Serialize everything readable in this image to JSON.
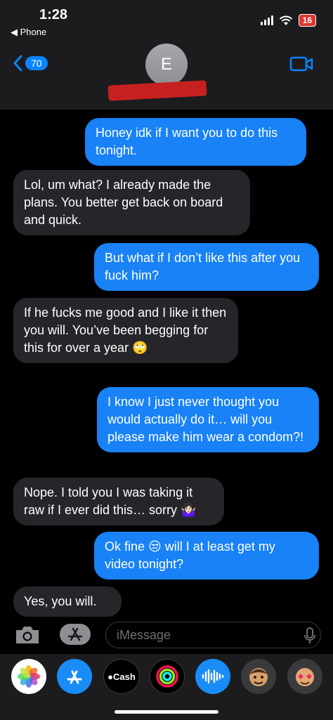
{
  "status": {
    "time": "1:28",
    "back_app": "◀ Phone",
    "battery": "16"
  },
  "header": {
    "back_badge": "70",
    "avatar_initial": "E",
    "back_icon": "chevron-left-icon",
    "video_icon": "video-camera-icon"
  },
  "messages": [
    {
      "side": "sent",
      "text": "Honey idk if I want you to do this tonight."
    },
    {
      "side": "received",
      "text": "Lol, um what? I already made the plans. You better get back on board and quick."
    },
    {
      "side": "sent",
      "text": "But what if I don’t like this after you fuck him?"
    },
    {
      "side": "received",
      "text": "If he fucks me good and I like it then you will. You’ve been begging for this for over a year 🙄"
    },
    {
      "side": "sent",
      "text": "I know I just never thought you would actually do it… will you please make him wear a condom?!"
    },
    {
      "side": "received",
      "text": "Nope. I told you I was taking it raw if I ever did this… sorry 🤷🏻‍♀️"
    },
    {
      "side": "sent",
      "text": "Ok fine 😒 will I at least get my video tonight?"
    },
    {
      "side": "received",
      "text": "Yes, you will."
    }
  ],
  "composer": {
    "placeholder": "iMessage",
    "camera_icon": "camera-icon",
    "apps_icon": "app-store-icon",
    "mic_icon": "microphone-icon"
  },
  "app_drawer": {
    "cash_label": "Cash",
    "apps": [
      "photos-icon",
      "app-store-icon",
      "apple-cash-icon",
      "activity-icon",
      "audio-message-icon",
      "memoji-icon",
      "memoji-stickers-icon"
    ]
  },
  "colors": {
    "sent_bubble": "#1882f6",
    "received_bubble": "#26252a",
    "accent": "#0a84ff"
  }
}
